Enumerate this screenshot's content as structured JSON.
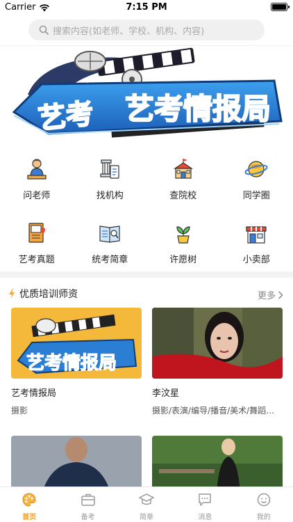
{
  "status_bar": {
    "carrier": "Carrier",
    "time": "7:15 PM"
  },
  "search": {
    "placeholder": "搜索内容(如老师、学校、机构、内容)"
  },
  "banner": {
    "logo_text": "艺考情报局"
  },
  "grid": [
    {
      "label": "问老师",
      "icon": "teacher-icon"
    },
    {
      "label": "找机构",
      "icon": "institution-icon"
    },
    {
      "label": "查院校",
      "icon": "school-icon"
    },
    {
      "label": "同学圈",
      "icon": "planet-icon"
    },
    {
      "label": "艺考真题",
      "icon": "book-heart-icon"
    },
    {
      "label": "统考简章",
      "icon": "newspaper-icon"
    },
    {
      "label": "许愿树",
      "icon": "plant-icon"
    },
    {
      "label": "小卖部",
      "icon": "shop-icon"
    }
  ],
  "section": {
    "title": "优质培训师资",
    "more": "更多"
  },
  "cards": [
    {
      "name": "艺考情报局",
      "sub": "摄影",
      "image_text": "艺考情报局"
    },
    {
      "name": "李汶星",
      "sub": "摄影/表演/编导/播音/美术/舞蹈…"
    }
  ],
  "tabs": [
    {
      "label": "首页",
      "active": true
    },
    {
      "label": "备考",
      "active": false
    },
    {
      "label": "简章",
      "active": false
    },
    {
      "label": "消息",
      "active": false
    },
    {
      "label": "我的",
      "active": false
    }
  ],
  "colors": {
    "accent": "#e8a030",
    "banner_blue": "#2a7fd4",
    "banner_red": "#e84a3a"
  }
}
